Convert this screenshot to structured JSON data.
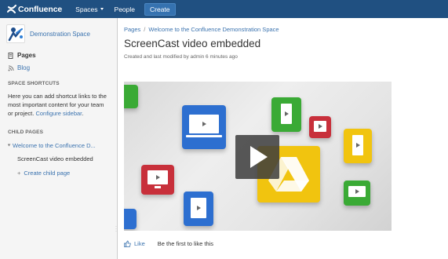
{
  "topbar": {
    "logo_text": "Confluence",
    "nav": [
      {
        "label": "Spaces",
        "has_dropdown": true
      },
      {
        "label": "People",
        "has_dropdown": false
      }
    ],
    "create_label": "Create",
    "bg_color": "#205081"
  },
  "sidebar": {
    "space_name": "Demonstration Space",
    "pages_label": "Pages",
    "blog_label": "Blog",
    "shortcuts_title": "SPACE SHORTCUTS",
    "shortcuts_text": "Here you can add shortcut links to the most important content for your team or project.",
    "shortcuts_link": "Configure sidebar",
    "shortcuts_end": ".",
    "children_title": "CHILD PAGES",
    "child_parent": "Welcome to the Confluence D...",
    "child_current": "ScreenCast video embedded",
    "create_child": "Create child page"
  },
  "main": {
    "breadcrumb": [
      "Pages",
      "Welcome to the Confluence Demonstration Space"
    ],
    "title": "ScreenCast video embedded",
    "meta": "Created and last modified by admin 6 minutes ago",
    "like_label": "Like",
    "like_text": "Be the first to like this"
  },
  "colors": {
    "link": "#3b73af",
    "tile_blue": "#2d6fd0",
    "tile_green": "#3aaa35",
    "tile_red": "#c8303b",
    "tile_yellow": "#f1c40f"
  }
}
